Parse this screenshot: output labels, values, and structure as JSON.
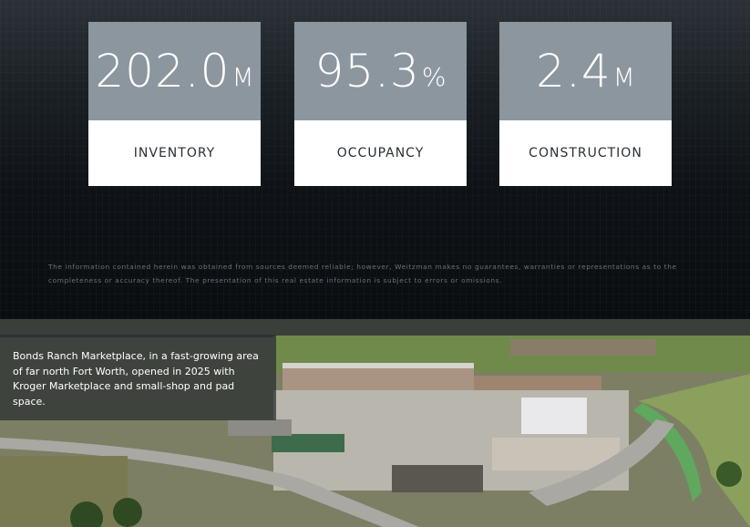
{
  "stats": [
    {
      "value": "202.0",
      "unit": "M",
      "label": "INVENTORY"
    },
    {
      "value": "95.3",
      "unit": "%",
      "label": "OCCUPANCY"
    },
    {
      "value": "2.4",
      "unit": "M",
      "label": "CONSTRUCTION"
    }
  ],
  "disclaimer": "The information contained herein was obtained from sources deemed reliable; however, Weitzman makes no guarantees, warranties or representations as to the completeness or accuracy thereof. The presentation of this real estate information is subject to errors or omissions.",
  "caption": "Bonds Ranch Marketplace, in a fast-growing area of far north Fort Worth, opened in 2025 with Kroger Marketplace and small-shop and pad space.",
  "colors": {
    "card_top": "#8c969f",
    "card_bottom": "#ffffff",
    "background": "#0b0f13"
  }
}
